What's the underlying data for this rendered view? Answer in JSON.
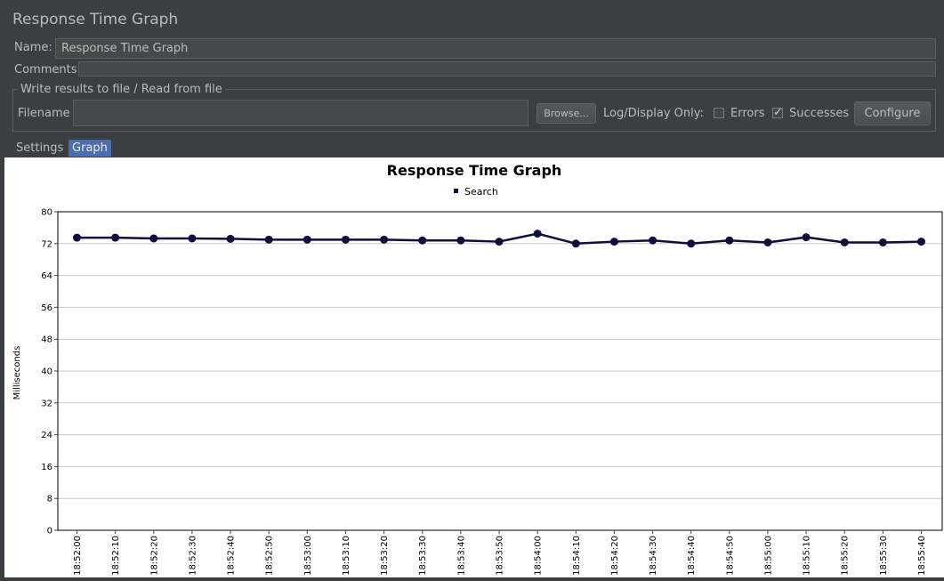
{
  "panel": {
    "title": "Response Time Graph"
  },
  "name": {
    "label": "Name:",
    "value": "Response Time Graph"
  },
  "comments": {
    "label": "Comments:",
    "value": ""
  },
  "file_group": {
    "title": "Write results to file / Read from file",
    "filename_label": "Filename",
    "filename_value": "",
    "browse_label": "Browse...",
    "log_display_label": "Log/Display Only:",
    "errors_label": "Errors",
    "errors_checked": false,
    "successes_label": "Successes",
    "successes_checked": true,
    "configure_label": "Configure"
  },
  "tabs": [
    {
      "label": "Settings",
      "active": false
    },
    {
      "label": "Graph",
      "active": true
    }
  ],
  "chart_data": {
    "type": "line",
    "title": "Response Time Graph",
    "ylabel": "Milliseconds",
    "xlabel": "",
    "ylim": [
      0,
      80
    ],
    "yticks": [
      0,
      8,
      16,
      24,
      32,
      40,
      48,
      56,
      64,
      72,
      80
    ],
    "grid": true,
    "legend_position": "top-center",
    "categories": [
      "18:52:00",
      "18:52:10",
      "18:52:20",
      "18:52:30",
      "18:52:40",
      "18:52:50",
      "18:53:00",
      "18:53:10",
      "18:53:20",
      "18:53:30",
      "18:53:40",
      "18:53:50",
      "18:54:00",
      "18:54:10",
      "18:54:20",
      "18:54:30",
      "18:54:40",
      "18:54:50",
      "18:55:00",
      "18:55:10",
      "18:55:20",
      "18:55:30",
      "18:55:40"
    ],
    "series": [
      {
        "name": "Search",
        "color": "#0f0f3c",
        "values": [
          73.5,
          73.5,
          73.3,
          73.3,
          73.2,
          73.0,
          73.0,
          73.0,
          73.0,
          72.8,
          72.8,
          72.5,
          74.5,
          72.0,
          72.5,
          72.8,
          72.0,
          72.8,
          72.3,
          73.6,
          72.3,
          72.3,
          72.5
        ]
      }
    ]
  }
}
